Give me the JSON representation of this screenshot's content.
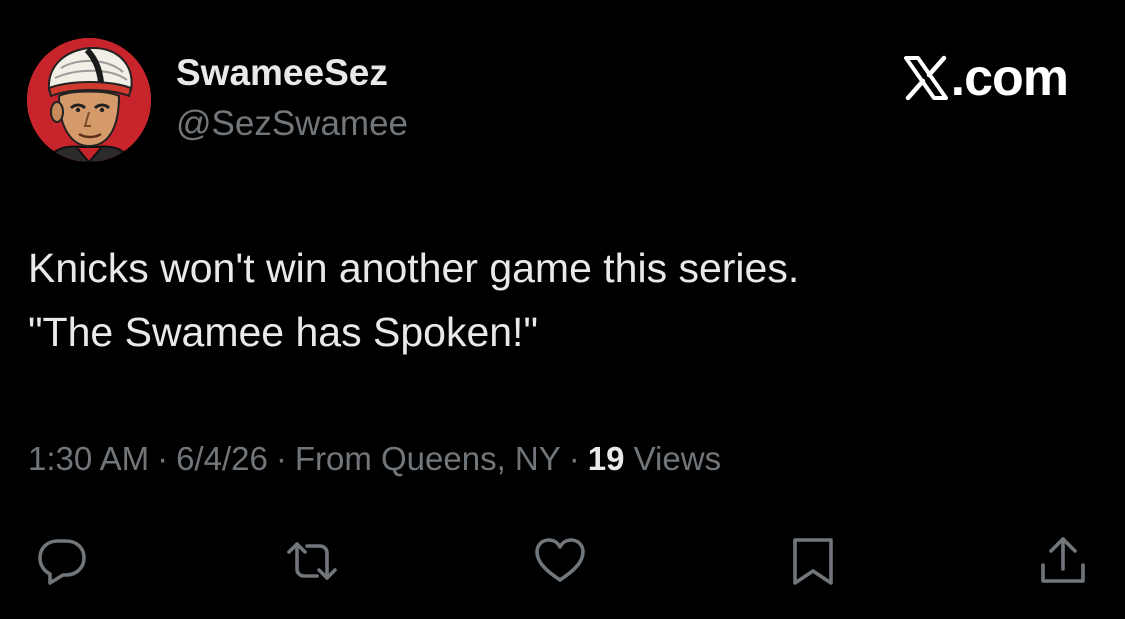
{
  "author": {
    "display_name": "SwameeSez",
    "handle": "@SezSwamee"
  },
  "brand": {
    "label": ".com",
    "icon": "x-logo-icon"
  },
  "tweet": {
    "lines": [
      "Knicks won't win another game this series.",
      "\"The Swamee has Spoken!\""
    ]
  },
  "meta": {
    "time": "1:30 AM",
    "date": "6/4/26",
    "location": "From Queens, NY",
    "views_count": "19",
    "views_label": "Views",
    "separator": "·"
  },
  "actions": [
    {
      "name": "reply",
      "icon": "reply-icon"
    },
    {
      "name": "retweet",
      "icon": "retweet-icon"
    },
    {
      "name": "like",
      "icon": "heart-icon"
    },
    {
      "name": "bookmark",
      "icon": "bookmark-icon"
    },
    {
      "name": "share",
      "icon": "share-icon"
    }
  ],
  "colors": {
    "background": "#000000",
    "primary_text": "#e7e9ea",
    "secondary_text": "#71767b",
    "avatar_bg": "#c8242b"
  }
}
